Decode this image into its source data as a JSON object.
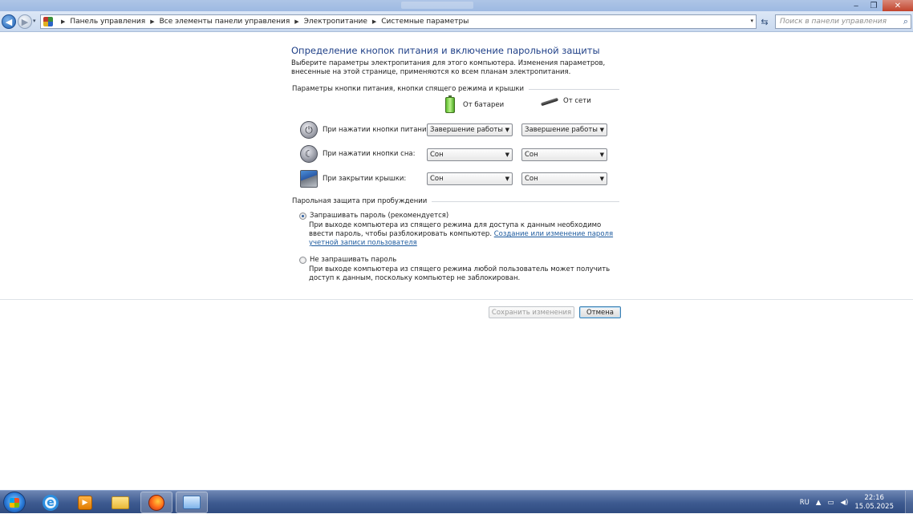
{
  "window": {
    "controls": {
      "minimize": "‒",
      "restore": "❐",
      "close": "✕"
    }
  },
  "nav": {
    "back_icon": "◀",
    "forward_icon": "▶",
    "history_icon": "▾",
    "breadcrumbs": [
      "Панель управления",
      "Все элементы панели управления",
      "Электропитание",
      "Системные параметры"
    ],
    "breadcrumb_sep": "▶",
    "address_drop": "▾",
    "refresh_icon": "⇆",
    "search_placeholder": "Поиск в панели управления",
    "search_icon": "⌕"
  },
  "main": {
    "title": "Определение кнопок питания и включение парольной защиты",
    "intro": "Выберите параметры электропитания для этого компьютера. Изменения параметров, внесенные на этой странице, применяются ко всем планам электропитания.",
    "group_buttons": "Параметры кнопки питания, кнопки спящего режима и крышки",
    "col_battery": "От батареи",
    "col_ac": "От сети",
    "rows": [
      {
        "label": "При нажатии кнопки питания:",
        "battery": "Завершение работы",
        "ac": "Завершение работы",
        "icon": "⏻"
      },
      {
        "label": "При нажатии кнопки сна:",
        "battery": "Сон",
        "ac": "Сон",
        "icon": "☾"
      },
      {
        "label": "При закрытии крышки:",
        "battery": "Сон",
        "ac": "Сон",
        "icon": ""
      }
    ],
    "select_arrow": "▼",
    "group_password": "Парольная защита при пробуждении",
    "opt_require": "Запрашивать пароль (рекомендуется)",
    "opt_require_desc": "При выходе компьютера из спящего режима для доступа к данным необходимо ввести пароль, чтобы разблокировать компьютер.",
    "opt_require_link": "Создание или изменение пароля учетной записи пользователя",
    "opt_norequire": "Не запрашивать пароль",
    "opt_norequire_desc": "При выходе компьютера из спящего режима любой пользователь может получить доступ к данным, поскольку компьютер не заблокирован.",
    "save_label": "Сохранить изменения",
    "cancel_label": "Отмена"
  },
  "taskbar": {
    "lang": "RU",
    "tray_arrow": "▲",
    "time": "22:16",
    "date": "15.05.2025",
    "media_glyph": "▶",
    "ie_glyph": "e"
  }
}
